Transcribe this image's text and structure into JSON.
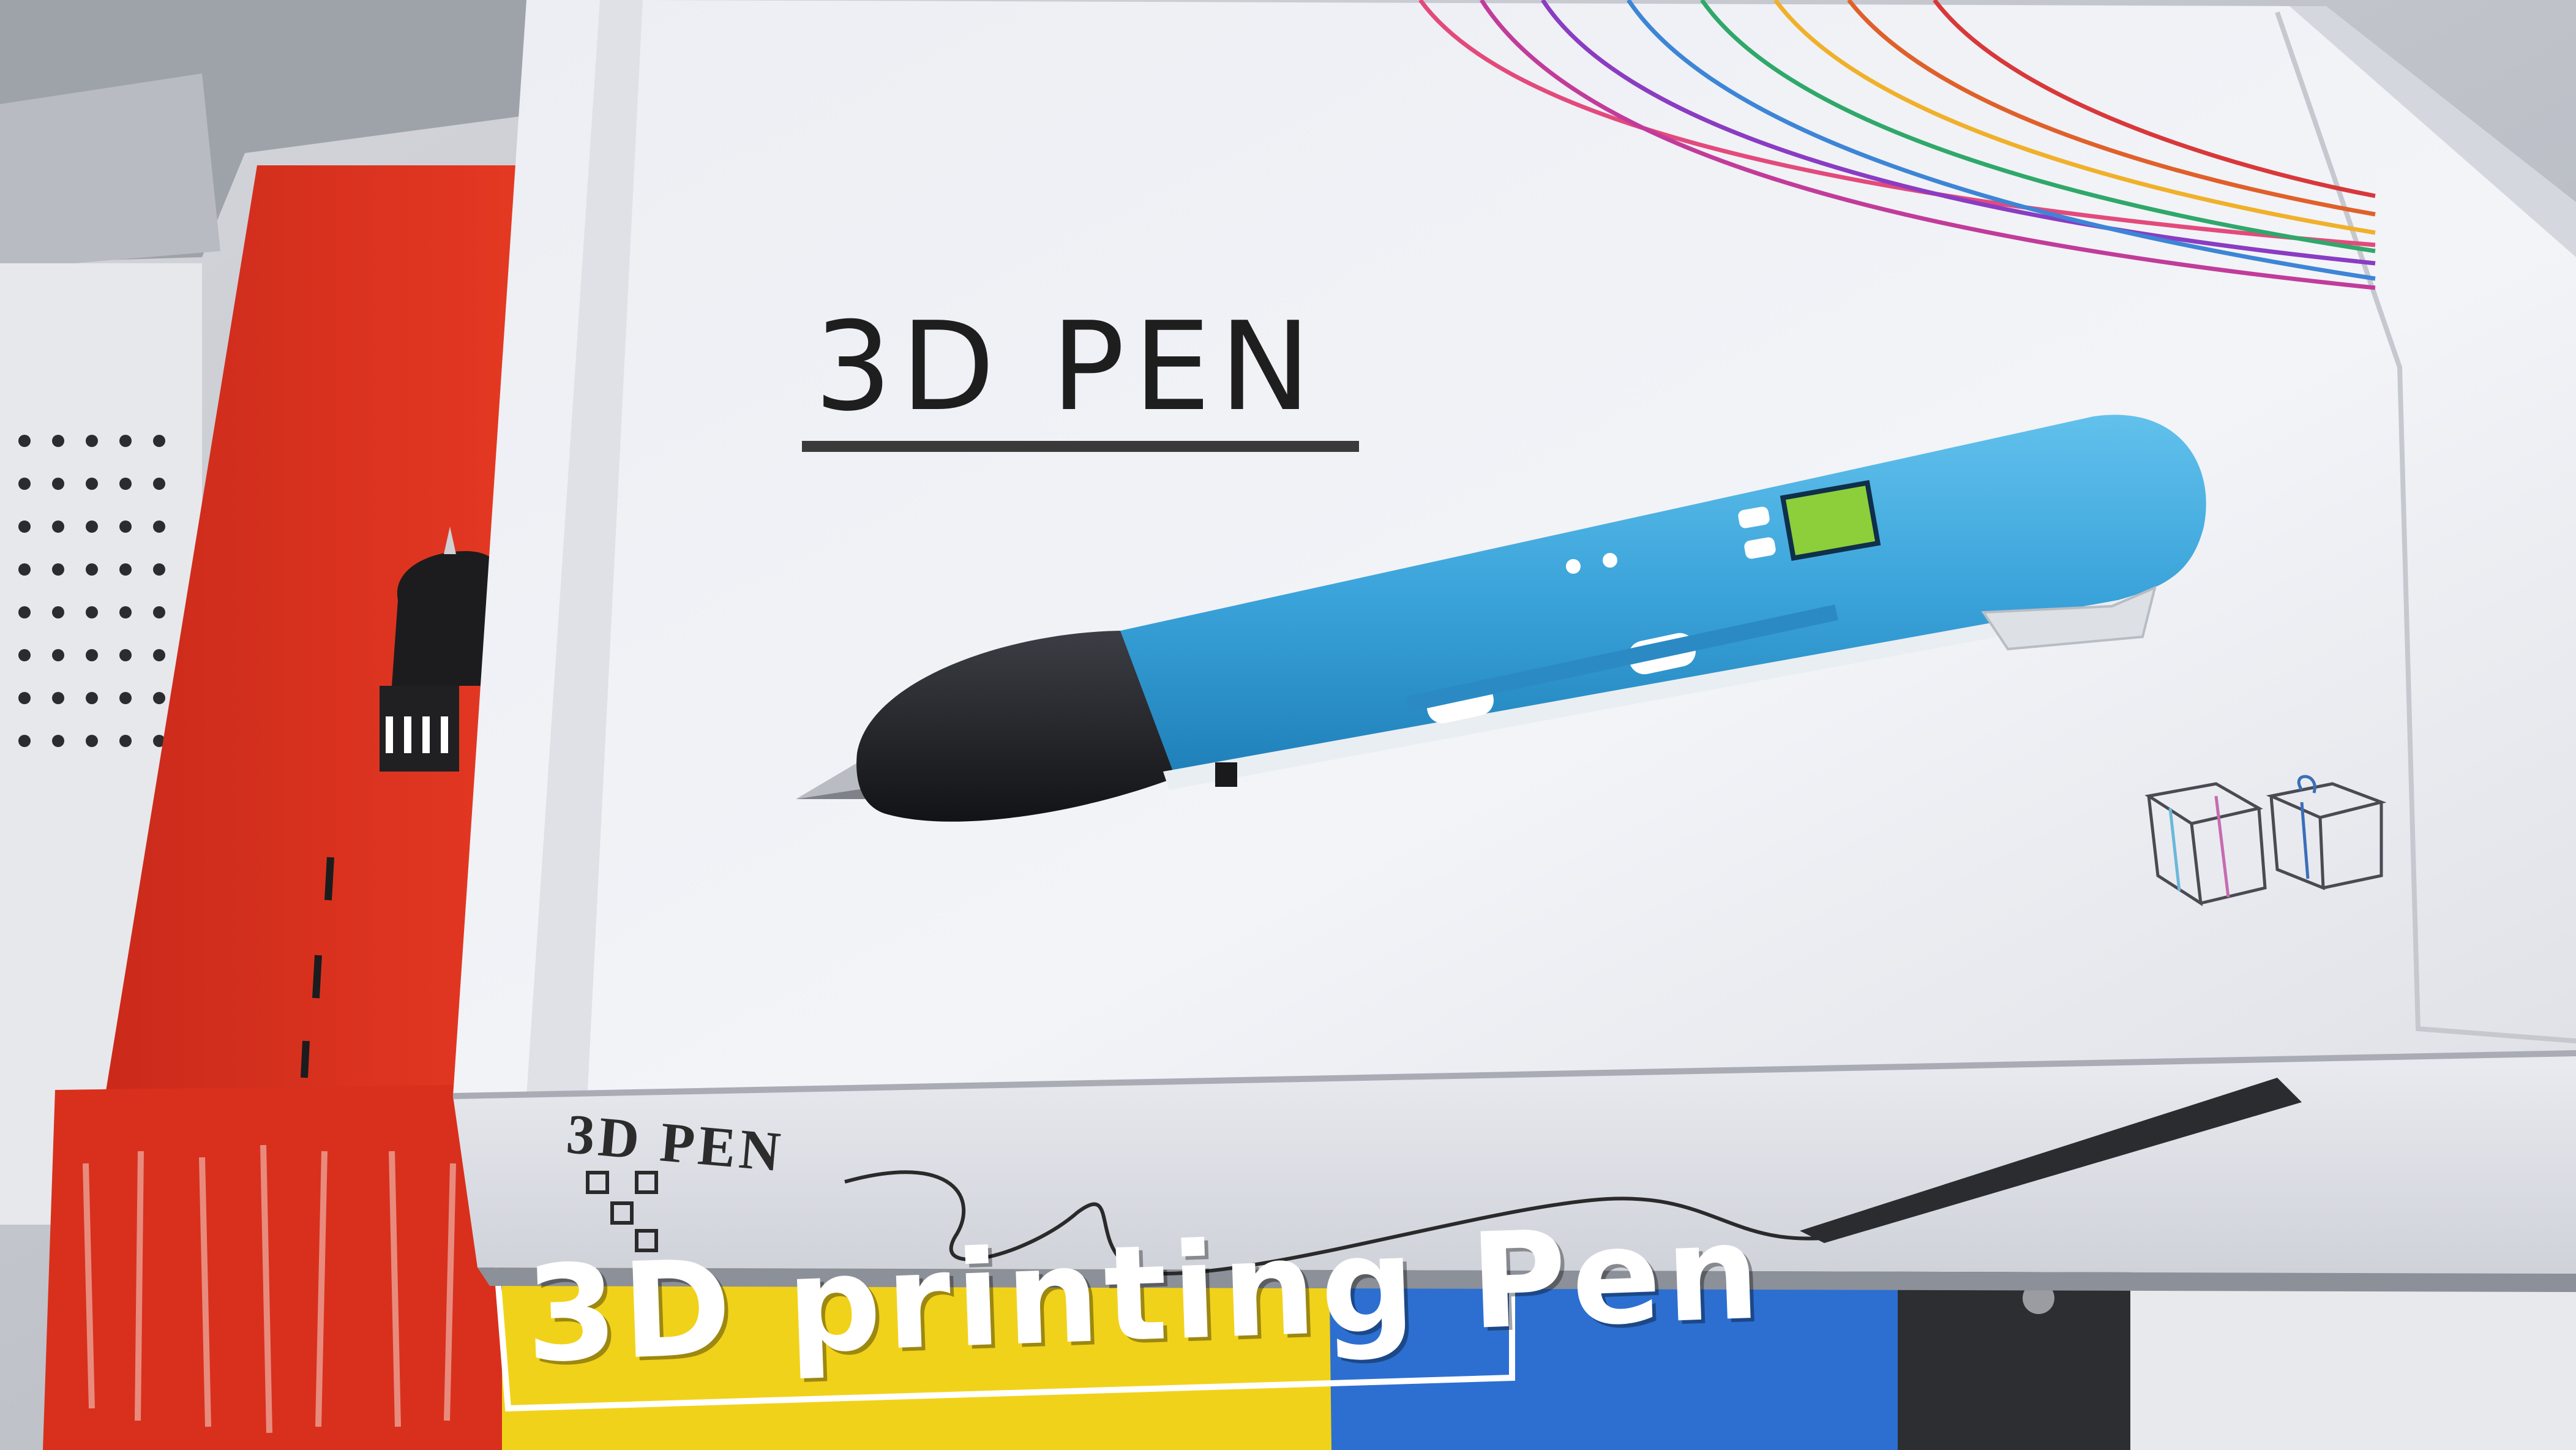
{
  "box": {
    "title": "3D PEN",
    "side_title": "3D PEN",
    "lower_box_text": "3D printing Pen"
  },
  "colors": {
    "box_white": "#f1f2f6",
    "pen_blue": "#3aa3da",
    "pen_tip_black": "#1d1f22",
    "red_box": "#e3331f",
    "yellow_box": "#f1d21a",
    "blue_box": "#2c6fd1"
  },
  "icons": {
    "gift_boxes": "gift-boxes-icon",
    "pen_display": "lcd-display-icon"
  }
}
